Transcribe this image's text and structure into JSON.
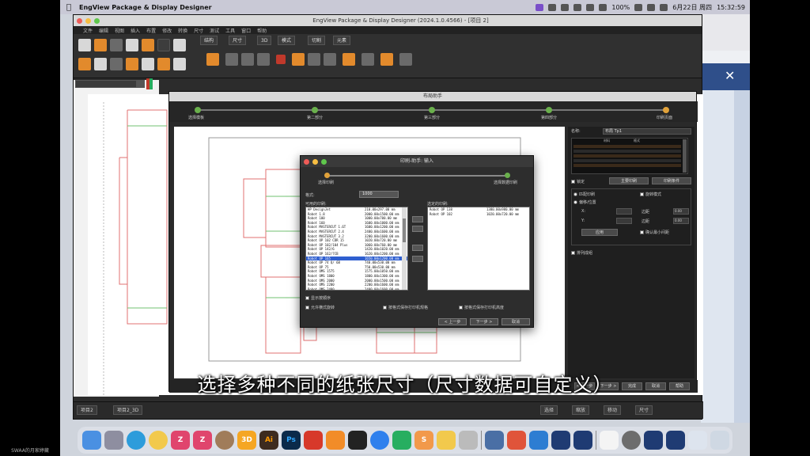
{
  "menubar": {
    "app_name": "EngView Package & Display Designer",
    "right_status": [
      "100%",
      "6月22日 周四",
      "15:32:59"
    ]
  },
  "window": {
    "title": "EngView Package & Display Designer (2024.1.0.4566) - [项目 2]",
    "menus": [
      "文件",
      "编辑",
      "视图",
      "插入",
      "布置",
      "修改",
      "转换",
      "尺寸",
      "测试",
      "工具",
      "窗口",
      "帮助"
    ],
    "toolbar_tabs": [
      "结构",
      "尺寸",
      "3D",
      "模式",
      "切割",
      "元素"
    ],
    "status_tabs": [
      "项目2",
      "项目2_3D"
    ],
    "status_right": [
      "选择",
      "缩放",
      "移动",
      "尺寸"
    ]
  },
  "layout_dialog": {
    "title": "布局助手",
    "steps": [
      "选择模板",
      "第二部分",
      "第三部分",
      "第四部分",
      "印刷页面"
    ],
    "props": {
      "name_label": "名称:",
      "name_value": "布局 Tp1",
      "table_headers": [
        "",
        "材料",
        "格式"
      ],
      "checkbox_label": "锁定",
      "button_1": "主要印刷",
      "button_2": "印刷条件",
      "radio_1": "匹配印刷",
      "radio_2": "偏移/位置",
      "option_check": "旋转模式",
      "x_label": "X:",
      "y_label": "Y:",
      "margin_label": "边距",
      "value_1": "0.00",
      "value_2": "0.00",
      "apply_button": "应用",
      "auto_check": "确认最小间距",
      "bottom_check": "排列成组"
    },
    "bottom_buttons": [
      "< 上一步",
      "下一步 >",
      "完成",
      "取消",
      "帮助"
    ]
  },
  "printer_dialog": {
    "title": "印刷-助手: 输入",
    "step_left": "选择印刷",
    "step_right": "选择数据印刷",
    "format_label": "格式:",
    "format_value": "1000",
    "available_label": "可用的印刷:",
    "selected_label": "选定的印刷:",
    "printers": [
      {
        "name": "HP DesignJet",
        "size": "210.00x297.00 mm"
      },
      {
        "name": "Robot 1.8",
        "size": "2000.00x1500.00 mm"
      },
      {
        "name": "Robot 100",
        "size": "1000.00x700.00 mm"
      },
      {
        "name": "Robot 160",
        "size": "1600.00x1000.00 mm"
      },
      {
        "name": "Robot MASTERCUT 1.6T",
        "size": "1600.00x1200.00 mm"
      },
      {
        "name": "Robot MASTERCUT 2.4",
        "size": "2400.00x1600.00 mm"
      },
      {
        "name": "Robot MASTERCUT 3.2",
        "size": "3200.00x1600.00 mm"
      },
      {
        "name": "Robot OP 102 CDR 15",
        "size": "1020.00x720.00 mm"
      },
      {
        "name": "Robot OP 102/104 Plus",
        "size": "1060.00x760.00 mm"
      },
      {
        "name": "Robot OP 142/6",
        "size": "1420.00x1020.00 mm"
      },
      {
        "name": "Robot OP 162/7CB",
        "size": "1620.00x1200.00 mm"
      },
      {
        "name": "Robot OP 165",
        "size": "1650.00x1200.00 mm"
      },
      {
        "name": "Robot OP 74 Q/ 6B",
        "size": "740.00x530.00 mm"
      },
      {
        "name": "Robot OP 75",
        "size": "750.00x530.00 mm"
      },
      {
        "name": "Robot OMS 1575",
        "size": "1575.00x1050.00 mm"
      },
      {
        "name": "Robot OMS 1800",
        "size": "1800.00x1300.00 mm"
      },
      {
        "name": "Robot OMS 2000",
        "size": "2000.00x1500.00 mm"
      },
      {
        "name": "Robot OMS 2200",
        "size": "2200.00x1600.00 mm"
      },
      {
        "name": "Robot OMS 2400",
        "size": "2400.00x1600.00 mm"
      },
      {
        "name": "Robot OMS 2800",
        "size": "2800.00x2000.00 mm"
      }
    ],
    "selected_index": 11,
    "selected_printers": [
      {
        "name": "Robot OP 138",
        "size": "1380.00x980.00 mm"
      },
      {
        "name": "Robot OP 102",
        "size": "1020.00x720.00 mm"
      }
    ],
    "check_1": "显示按顺序",
    "check_2": "允许横式旋转",
    "check_3": "按格式保存打印机规格",
    "check_4": "按格式保存打印机高度",
    "btn_back": "< 上一步",
    "btn_next": "下一步 >",
    "btn_cancel": "取消"
  },
  "subtitle": "选择多种不同的纸张尺寸（尺寸数据可自定义）",
  "dock_labels": [
    "Z",
    "Z",
    "3D",
    "Ai",
    "Ps",
    "S"
  ],
  "corner_label": "SWAA的月家婷藏"
}
